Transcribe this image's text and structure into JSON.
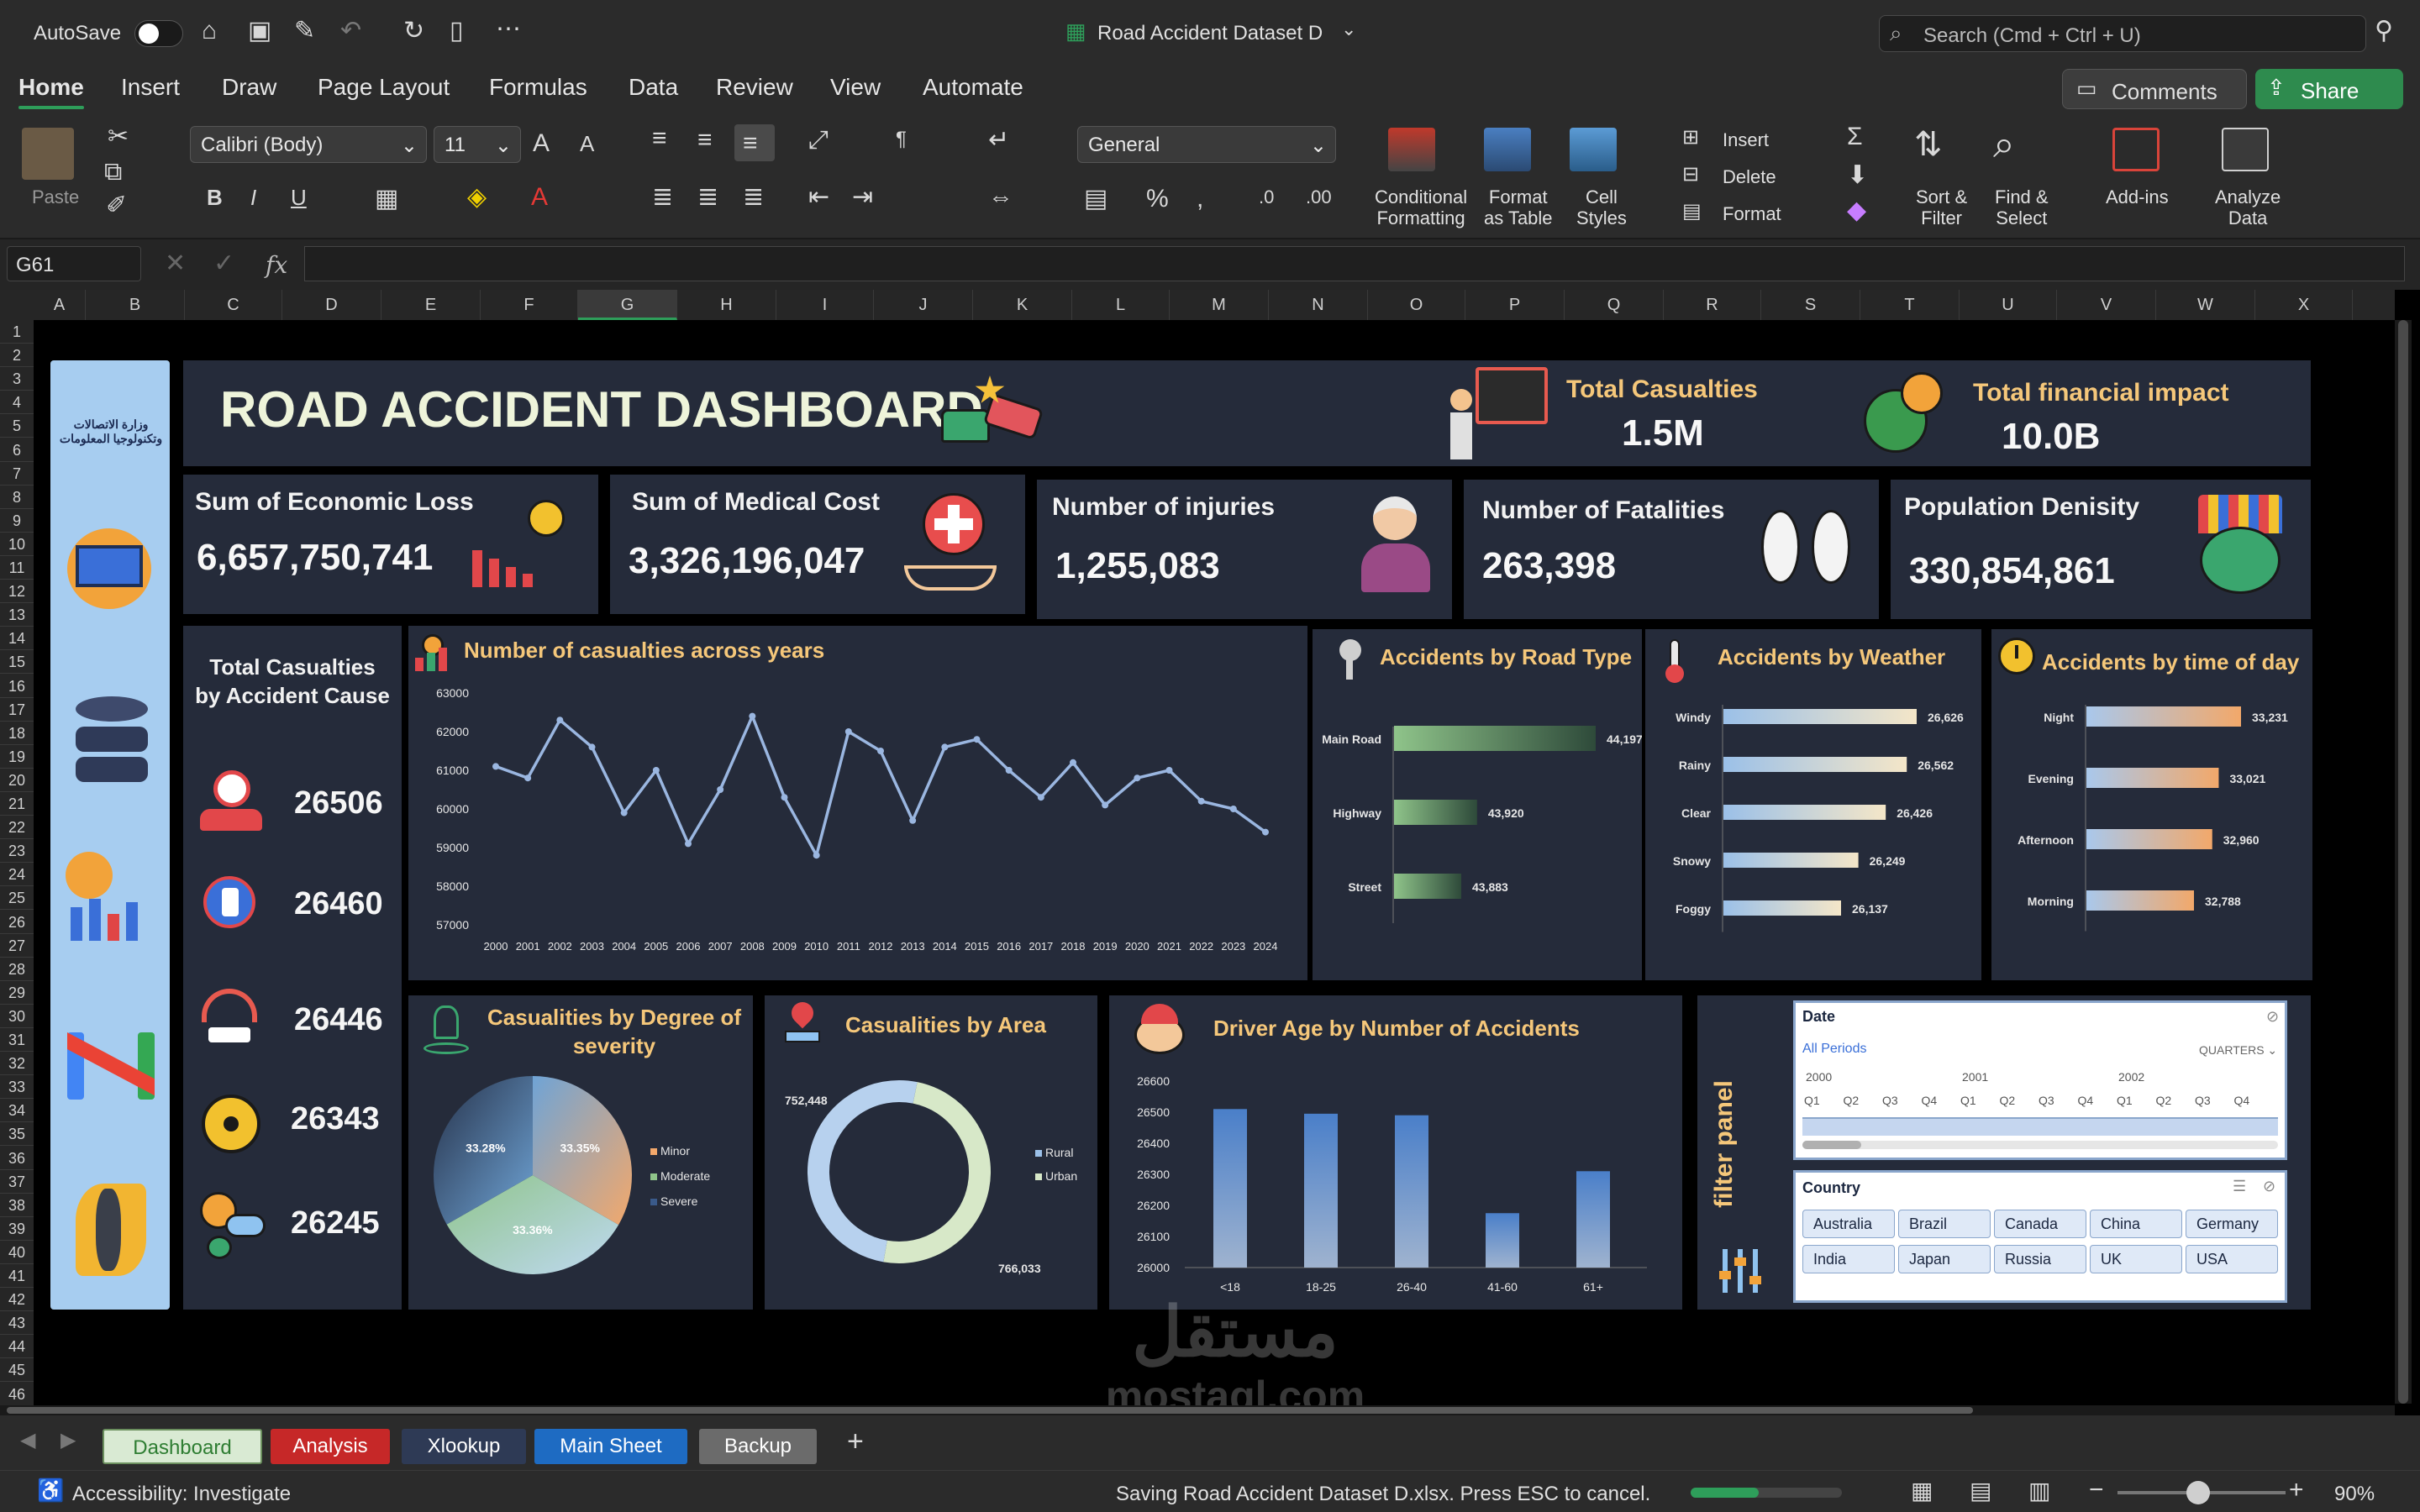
{
  "titlebar": {
    "autosave_label": "AutoSave",
    "doc_title": "Road Accident Dataset D",
    "search_placeholder": "Search (Cmd + Ctrl + U)"
  },
  "ribbon_tabs": [
    "Home",
    "Insert",
    "Draw",
    "Page Layout",
    "Formulas",
    "Data",
    "Review",
    "View",
    "Automate"
  ],
  "ribbon_buttons": {
    "comments": "Comments",
    "share": "Share",
    "paste": "Paste",
    "font_name": "Calibri (Body)",
    "font_size": "11",
    "number_format": "General",
    "conditional_formatting": [
      "Conditional",
      "Formatting"
    ],
    "format_as_table": [
      "Format",
      "as Table"
    ],
    "cell_styles": [
      "Cell",
      "Styles"
    ],
    "insert": "Insert",
    "delete": "Delete",
    "format": "Format",
    "sort_filter": [
      "Sort &",
      "Filter"
    ],
    "find_select": [
      "Find &",
      "Select"
    ],
    "add_ins": "Add-ins",
    "analyze_data": [
      "Analyze",
      "Data"
    ]
  },
  "formula_bar": {
    "name_box": "G61",
    "fx": "fx",
    "formula": ""
  },
  "columns": [
    "A",
    "B",
    "C",
    "D",
    "E",
    "F",
    "G",
    "H",
    "I",
    "J",
    "K",
    "L",
    "M",
    "N",
    "O",
    "P",
    "Q",
    "R",
    "S",
    "T",
    "U",
    "V",
    "W",
    "X"
  ],
  "rows": [
    "1",
    "2",
    "3",
    "4",
    "5",
    "6",
    "7",
    "8",
    "9",
    "10",
    "11",
    "12",
    "13",
    "14",
    "15",
    "16",
    "17",
    "18",
    "19",
    "20",
    "21",
    "22",
    "23",
    "24",
    "25",
    "26",
    "27",
    "28",
    "29",
    "30",
    "31",
    "32",
    "33",
    "34",
    "35",
    "36",
    "37",
    "38",
    "39",
    "40",
    "41",
    "42",
    "43",
    "44",
    "45",
    "46"
  ],
  "dashboard": {
    "title": "ROAD ACCIDENT DASHBOARD",
    "logo_text": "وزارة الاتصالات وتكنولوجيا المعلومات",
    "total_casualties_label": "Total Casualties",
    "total_casualties_value": "1.5M",
    "financial_impact_label": "Total financial impact",
    "financial_impact_value": "10.0B",
    "kpis": [
      {
        "label": "Sum of Economic Loss",
        "value": "6,657,750,741"
      },
      {
        "label": "Sum of Medical Cost",
        "value": "3,326,196,047"
      },
      {
        "label": "Number of injuries",
        "value": "1,255,083"
      },
      {
        "label": "Number of Fatalities",
        "value": "263,398"
      },
      {
        "label": "Population Denisity",
        "value": "330,854,861"
      }
    ],
    "cause_title": [
      "Total Casualties",
      "by Accident Cause"
    ],
    "causes": [
      "26506",
      "26460",
      "26446",
      "26343",
      "26245"
    ],
    "filter_panel_label": "filter panel"
  },
  "chart_data": [
    {
      "type": "line",
      "title": "Number of casualties across years",
      "x": [
        "2000",
        "2001",
        "2002",
        "2003",
        "2004",
        "2005",
        "2006",
        "2007",
        "2008",
        "2009",
        "2010",
        "2011",
        "2012",
        "2013",
        "2014",
        "2015",
        "2016",
        "2017",
        "2018",
        "2019",
        "2020",
        "2021",
        "2022",
        "2023",
        "2024"
      ],
      "values": [
        61100,
        60800,
        62300,
        61600,
        59900,
        61000,
        59100,
        60500,
        62400,
        60300,
        58800,
        62000,
        61500,
        59700,
        61600,
        61800,
        61000,
        60300,
        61200,
        60100,
        60800,
        61000,
        60200,
        60000,
        59400
      ],
      "ylim": [
        57000,
        63000
      ],
      "yticks": [
        "63000",
        "62000",
        "61000",
        "60000",
        "59000",
        "58000",
        "57000"
      ],
      "color": "#9ab6e0"
    },
    {
      "type": "bar",
      "orientation": "horizontal",
      "title": "Accidents by Road Type",
      "categories": [
        "Main Road",
        "Highway",
        "Street"
      ],
      "values": [
        44197,
        43920,
        43883
      ],
      "labels": [
        "44,197",
        "43,920",
        "43,883"
      ]
    },
    {
      "type": "bar",
      "orientation": "horizontal",
      "title": "Accidents by Weather",
      "categories": [
        "Windy",
        "Rainy",
        "Clear",
        "Snowy",
        "Foggy"
      ],
      "values": [
        26626,
        26562,
        26426,
        26249,
        26137
      ],
      "labels": [
        "26,626",
        "26,562",
        "26,426",
        "26,249",
        "26,137"
      ]
    },
    {
      "type": "bar",
      "orientation": "horizontal",
      "title": "Accidents by time of day",
      "categories": [
        "Night",
        "Evening",
        "Afternoon",
        "Morning"
      ],
      "values": [
        33231,
        33021,
        32960,
        32788
      ],
      "labels": [
        "33,231",
        "33,021",
        "32,960",
        "32,788"
      ]
    },
    {
      "type": "pie",
      "title": "Casualities by Degree of severity",
      "categories": [
        "Minor",
        "Moderate",
        "Severe"
      ],
      "values": [
        33.35,
        33.36,
        33.28
      ],
      "labels": [
        "33.35%",
        "33.36%",
        "33.28%"
      ]
    },
    {
      "type": "pie",
      "subtype": "donut",
      "title": "Casualities by Area",
      "categories": [
        "Rural",
        "Urban"
      ],
      "values": [
        752448,
        766033
      ],
      "labels": [
        "752,448",
        "766,033"
      ]
    },
    {
      "type": "bar",
      "title": "Driver Age by Number of Accidents",
      "categories": [
        "<18",
        "18-25",
        "26-40",
        "41-60",
        "61+"
      ],
      "values": [
        26510,
        26495,
        26490,
        26175,
        26310
      ],
      "ylim": [
        26000,
        26600
      ],
      "yticks": [
        "26600",
        "26500",
        "26400",
        "26300",
        "26200",
        "26100",
        "26000"
      ]
    }
  ],
  "slicers": {
    "date_title": "Date",
    "date_all": "All Periods",
    "date_level": "QUARTERS",
    "years": [
      "2000",
      "2001",
      "2002"
    ],
    "quarters": [
      "Q1",
      "Q2",
      "Q3",
      "Q4",
      "Q1",
      "Q2",
      "Q3",
      "Q4",
      "Q1",
      "Q2",
      "Q3",
      "Q4"
    ],
    "country_title": "Country",
    "countries": [
      "Australia",
      "Brazil",
      "Canada",
      "China",
      "Germany",
      "India",
      "Japan",
      "Russia",
      "UK",
      "USA"
    ]
  },
  "sheet_tabs": [
    {
      "label": "Dashboard",
      "bg": "#d9ead3",
      "fg": "#2e7d32"
    },
    {
      "label": "Analysis",
      "bg": "#c62828",
      "fg": "#ffffff"
    },
    {
      "label": "Xlookup",
      "bg": "#2e3a55",
      "fg": "#ffffff"
    },
    {
      "label": "Main Sheet",
      "bg": "#1e6bc2",
      "fg": "#ffffff"
    },
    {
      "label": "Backup",
      "bg": "#6b6b6b",
      "fg": "#ffffff"
    }
  ],
  "watermark": {
    "arabic": "مستقل",
    "latin": "mostaql.com"
  },
  "status": {
    "accessibility": "Accessibility: Investigate",
    "saving": "Saving Road Accident Dataset D.xlsx. Press ESC to cancel.",
    "zoom": "90%",
    "save_progress": 0.45
  }
}
